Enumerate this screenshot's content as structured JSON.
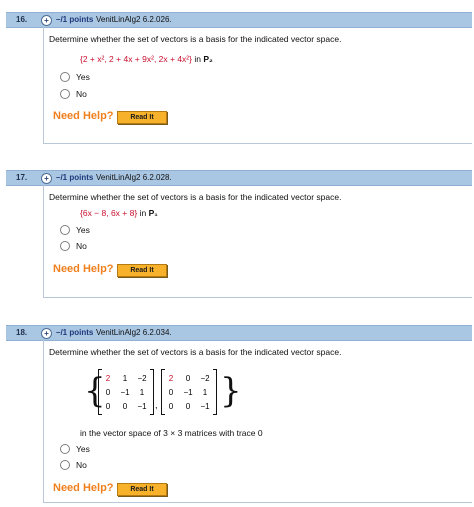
{
  "questions": [
    {
      "number": "16.",
      "points": "–/1 points",
      "code": "VenitLinAlg2 6.2.026.",
      "prompt": "Determine whether the set of vectors is a basis for the indicated vector space.",
      "set_expr": "{2 + x², 2 + 4x + 9x², 2x + 4x²}",
      "space_in": "in",
      "space": "P₂",
      "options": [
        "Yes",
        "No"
      ],
      "help_label": "Need Help?",
      "read_button": "Read It"
    },
    {
      "number": "17.",
      "points": "–/1 points",
      "code": "VenitLinAlg2 6.2.028.",
      "prompt": "Determine whether the set of vectors is a basis for the indicated vector space.",
      "set_expr": "{6x − 8, 6x + 8}",
      "space_in": "in",
      "space": "P₁",
      "options": [
        "Yes",
        "No"
      ],
      "help_label": "Need Help?",
      "read_button": "Read It"
    },
    {
      "number": "18.",
      "points": "–/1 points",
      "code": "VenitLinAlg2 6.2.034.",
      "prompt": "Determine whether the set of vectors is a basis for the indicated vector space.",
      "matrix_a": [
        [
          "2",
          "1",
          "−2"
        ],
        [
          "0",
          "−1",
          "1"
        ],
        [
          "0",
          "0",
          "−1"
        ]
      ],
      "matrix_b": [
        [
          "2",
          "0",
          "−2"
        ],
        [
          "0",
          "−1",
          "1"
        ],
        [
          "0",
          "0",
          "−1"
        ]
      ],
      "space_text": "in the vector space of 3 × 3 matrices with trace 0",
      "options": [
        "Yes",
        "No"
      ],
      "help_label": "Need Help?",
      "read_button": "Read It"
    }
  ],
  "colors": {
    "header_bg": "#a9c6e3",
    "points_text": "#1f3a7a",
    "math_red": "#c8102e",
    "help_orange": "#f07f1e",
    "read_button": "#f8b12a"
  }
}
